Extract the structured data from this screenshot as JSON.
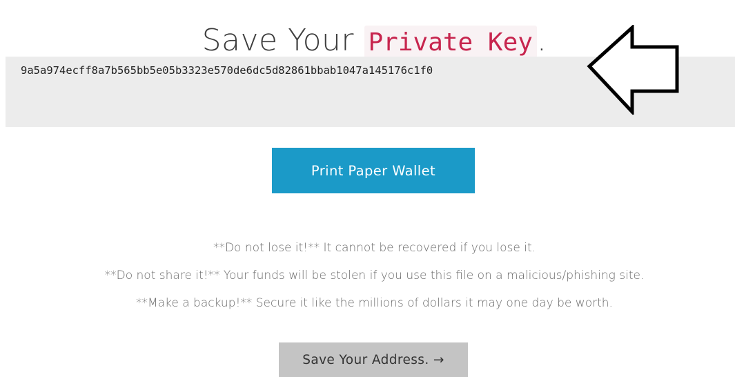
{
  "header": {
    "title_prefix": "Save Your",
    "title_highlight": "Private Key",
    "title_suffix": "."
  },
  "private_key": {
    "value": "9a5a974ecff8a7b565bb5e05b3323e570de6dc5d82861bbab1047a145176c1f0"
  },
  "annotation": {
    "icon": "left-arrow-outline-icon"
  },
  "actions": {
    "print_label": "Print Paper Wallet",
    "next_label": "Save Your Address. →"
  },
  "warnings": [
    "**Do not lose it!** It cannot be recovered if you lose it.",
    "**Do not share it!** Your funds will be stolen if you use this file on a malicious/phishing site.",
    "**Make a backup!** Secure it like the millions of dollars it may one day be worth."
  ],
  "colors": {
    "accent": "#1b9ac8",
    "code_text": "#c7254e",
    "code_background": "#f9f2f4",
    "key_box_background": "#ececec",
    "secondary_button": "#c4c4c4"
  }
}
